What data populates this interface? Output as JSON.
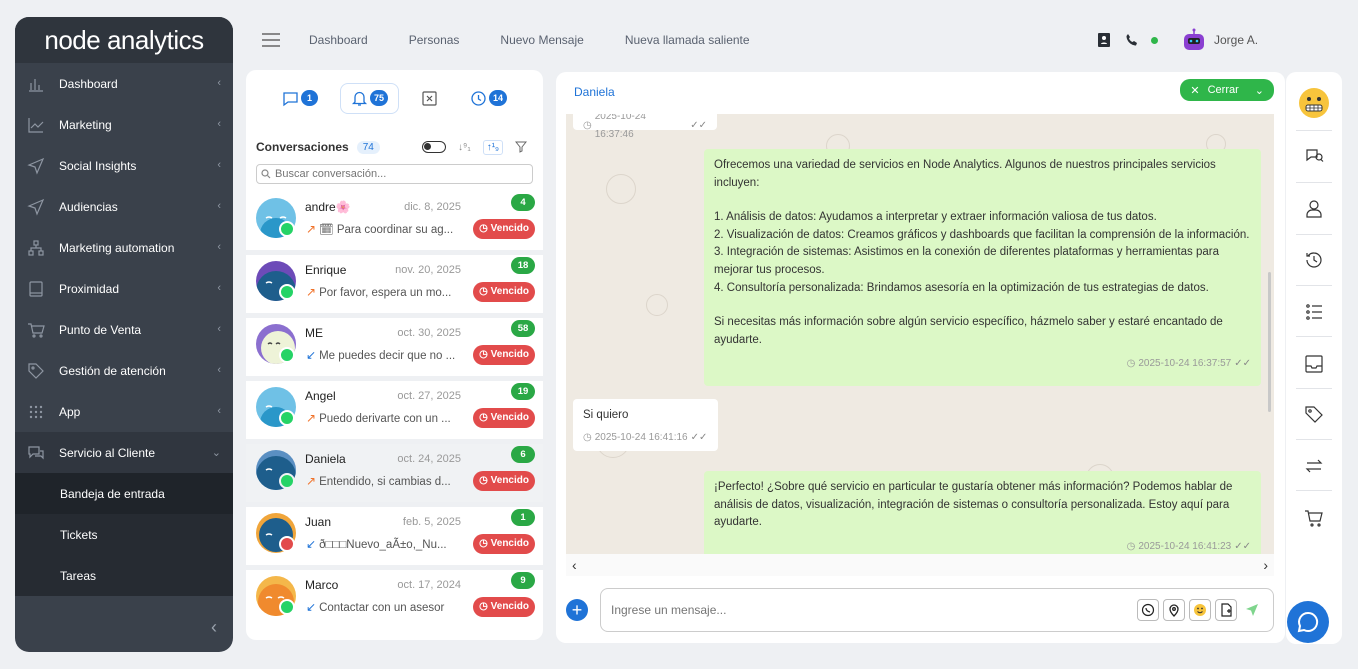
{
  "app": {
    "logo": "node analytics"
  },
  "sidebar": {
    "items": [
      {
        "label": "Dashboard",
        "icon": "bar-chart-icon"
      },
      {
        "label": "Marketing",
        "icon": "line-chart-icon"
      },
      {
        "label": "Social Insights",
        "icon": "send-icon"
      },
      {
        "label": "Audiencias",
        "icon": "send-icon"
      },
      {
        "label": "Marketing automation",
        "icon": "sitemap-icon"
      },
      {
        "label": "Proximidad",
        "icon": "tablet-icon"
      },
      {
        "label": "Punto de Venta",
        "icon": "cart-icon"
      },
      {
        "label": "Gestión de atención",
        "icon": "tag-icon"
      },
      {
        "label": "App",
        "icon": "grid-dots-icon"
      },
      {
        "label": "Servicio al Cliente",
        "icon": "chat-icon"
      }
    ],
    "subitems": [
      "Bandeja de entrada",
      "Tickets",
      "Tareas"
    ]
  },
  "topnav": {
    "links": [
      "Dashboard",
      "Personas",
      "Nuevo Mensaje",
      "Nueva llamada saliente"
    ],
    "user": "Jorge A.",
    "status_color": "#2fb64a"
  },
  "convpanel": {
    "tabs": [
      {
        "icon": "message-icon",
        "count": "1"
      },
      {
        "icon": "bell-icon",
        "count": "75"
      },
      {
        "icon": "close-box-icon",
        "count": ""
      },
      {
        "icon": "clock-icon",
        "count": "14"
      }
    ],
    "title": "Conversaciones",
    "count": "74",
    "search_placeholder": "Buscar conversación...",
    "conversations": [
      {
        "name": "andre",
        "date": "dic. 8, 2025",
        "preview": "🗓 Para coordinar su ag...",
        "badge": "4",
        "status": "Vencido",
        "direction": "out",
        "channel": "whatsapp"
      },
      {
        "name": "Enrique",
        "date": "nov. 20, 2025",
        "preview": "Por favor, espera un mo...",
        "badge": "18",
        "status": "Vencido",
        "direction": "out",
        "channel": "whatsapp"
      },
      {
        "name": "ME",
        "date": "oct. 30, 2025",
        "preview": "Me puedes decir que no ...",
        "badge": "58",
        "status": "Vencido",
        "direction": "in",
        "channel": "whatsapp"
      },
      {
        "name": "Angel",
        "date": "oct. 27, 2025",
        "preview": "Puedo derivarte con un ...",
        "badge": "19",
        "status": "Vencido",
        "direction": "out",
        "channel": "whatsapp"
      },
      {
        "name": "Daniela",
        "date": "oct. 24, 2025",
        "preview": "Entendido, si cambias d...",
        "badge": "6",
        "status": "Vencido",
        "direction": "out",
        "channel": "whatsapp"
      },
      {
        "name": "Juan",
        "date": "feb. 5, 2025",
        "preview": "ð□□□Nuevo_aÃ±o,_Nu...",
        "badge": "1",
        "status": "Vencido",
        "direction": "in",
        "channel": "email"
      },
      {
        "name": "Marco",
        "date": "oct. 17, 2024",
        "preview": "Contactar con un asesor",
        "badge": "9",
        "status": "Vencido",
        "direction": "in",
        "channel": "whatsapp"
      }
    ]
  },
  "chat": {
    "contact": "Daniela",
    "close_label": "Cerrar",
    "messages": [
      {
        "type": "in",
        "text": "",
        "time": "2025-10-24 16:37:46"
      },
      {
        "type": "out",
        "p1": "Ofrecemos una variedad de servicios en Node Analytics. Algunos de nuestros principales servicios incluyen:",
        "items": [
          "1. Análisis de datos: Ayudamos a interpretar y extraer información valiosa de tus datos.",
          "2. Visualización de datos: Creamos gráficos y dashboards que facilitan la comprensión de la información.",
          "3. Integración de sistemas: Asistimos en la conexión de diferentes plataformas y herramientas para mejorar tus procesos.",
          "4. Consultoría personalizada: Brindamos asesoría en la optimización de tus estrategias de datos."
        ],
        "p2": "Si necesitas más información sobre algún servicio específico, házmelo saber y estaré encantado de ayudarte.",
        "time": "2025-10-24 16:37:57"
      },
      {
        "type": "in",
        "text": "Si quiero",
        "time": "2025-10-24 16:41:16"
      },
      {
        "type": "out",
        "text": "¡Perfecto! ¿Sobre qué servicio en particular te gustaría obtener más información? Podemos hablar de análisis de datos, visualización, integración de sistemas o consultoría personalizada. Estoy aquí para ayudarte.",
        "time": "2025-10-24 16:41:23"
      }
    ],
    "input_placeholder": "Ingrese un mensaje..."
  },
  "colors": {
    "primary": "#1f73d7",
    "success": "#2fb64a",
    "danger": "#e24b4b",
    "sidebar": "#3a414b"
  }
}
